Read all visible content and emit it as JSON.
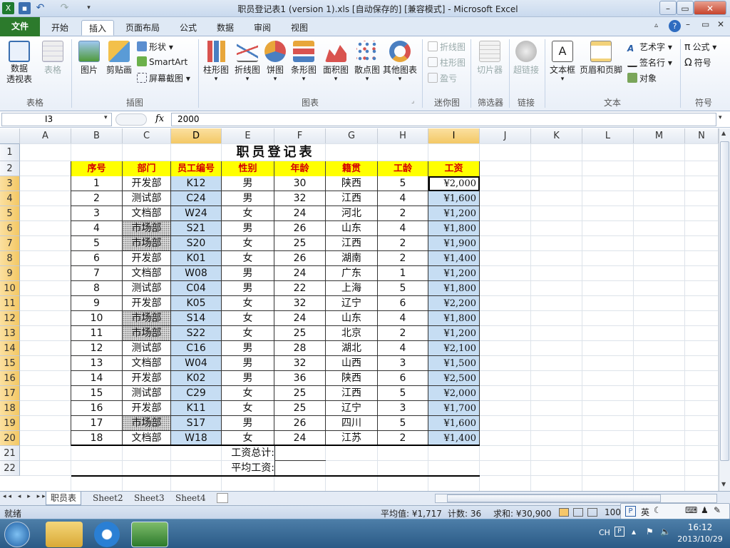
{
  "titlebar": {
    "title": "职员登记表1 (version 1).xls [自动保存的]  [兼容模式] - Microsoft Excel",
    "minimize": "–",
    "restore": "▭",
    "close": "✕"
  },
  "tabs": {
    "file": "文件",
    "home": "开始",
    "insert": "插入",
    "page_layout": "页面布局",
    "formulas": "公式",
    "data": "数据",
    "review": "审阅",
    "view": "视图"
  },
  "ribbon": {
    "pivot": "数据\n透视表",
    "table": "表格",
    "group_tables": "表格",
    "picture": "图片",
    "clipart": "剪贴画",
    "shapes": "形状",
    "smartart": "SmartArt",
    "screenshot": "屏幕截图",
    "group_illustrations": "插图",
    "column_chart": "柱形图",
    "line_chart": "折线图",
    "pie_chart": "饼图",
    "bar_chart": "条形图",
    "area_chart": "面积图",
    "scatter_chart": "散点图",
    "other_charts": "其他图表",
    "group_charts": "图表",
    "spark_line": "折线图",
    "spark_column": "柱形图",
    "spark_winloss": "盈亏",
    "group_sparklines": "迷你图",
    "slicer": "切片器",
    "group_filter": "筛选器",
    "hyperlink": "超链接",
    "group_links": "链接",
    "textbox": "文本框",
    "header_footer": "页眉和页脚",
    "wordart": "艺术字",
    "signature": "签名行",
    "object": "对象",
    "group_text": "文本",
    "equation": "公式",
    "symbol": "符号",
    "group_symbols": "符号"
  },
  "formula_bar": {
    "name_box": "I3",
    "fx": "fx",
    "value": "2000"
  },
  "columns": [
    "A",
    "B",
    "C",
    "D",
    "E",
    "F",
    "G",
    "H",
    "I",
    "J",
    "K",
    "L",
    "M",
    "N"
  ],
  "rows": [
    "1",
    "2",
    "3",
    "4",
    "5",
    "6",
    "7",
    "8",
    "9",
    "10",
    "11",
    "12",
    "13",
    "14",
    "15",
    "16",
    "17",
    "18",
    "19",
    "20",
    "21",
    "22"
  ],
  "sheet": {
    "title": "职员登记表",
    "headers": [
      "序号",
      "部门",
      "员工编号",
      "性别",
      "年龄",
      "籍贯",
      "工龄",
      "工资"
    ],
    "records": [
      [
        "1",
        "开发部",
        "K12",
        "男",
        "30",
        "陕西",
        "5",
        "¥2,000"
      ],
      [
        "2",
        "测试部",
        "C24",
        "男",
        "32",
        "江西",
        "4",
        "¥1,600"
      ],
      [
        "3",
        "文档部",
        "W24",
        "女",
        "24",
        "河北",
        "2",
        "¥1,200"
      ],
      [
        "4",
        "市场部",
        "S21",
        "男",
        "26",
        "山东",
        "4",
        "¥1,800"
      ],
      [
        "5",
        "市场部",
        "S20",
        "女",
        "25",
        "江西",
        "2",
        "¥1,900"
      ],
      [
        "6",
        "开发部",
        "K01",
        "女",
        "26",
        "湖南",
        "2",
        "¥1,400"
      ],
      [
        "7",
        "文档部",
        "W08",
        "男",
        "24",
        "广东",
        "1",
        "¥1,200"
      ],
      [
        "8",
        "测试部",
        "C04",
        "男",
        "22",
        "上海",
        "5",
        "¥1,800"
      ],
      [
        "9",
        "开发部",
        "K05",
        "女",
        "32",
        "辽宁",
        "6",
        "¥2,200"
      ],
      [
        "10",
        "市场部",
        "S14",
        "女",
        "24",
        "山东",
        "4",
        "¥1,800"
      ],
      [
        "11",
        "市场部",
        "S22",
        "女",
        "25",
        "北京",
        "2",
        "¥1,200"
      ],
      [
        "12",
        "测试部",
        "C16",
        "男",
        "28",
        "湖北",
        "4",
        "¥2,100"
      ],
      [
        "13",
        "文档部",
        "W04",
        "男",
        "32",
        "山西",
        "3",
        "¥1,500"
      ],
      [
        "14",
        "开发部",
        "K02",
        "男",
        "36",
        "陕西",
        "6",
        "¥2,500"
      ],
      [
        "15",
        "测试部",
        "C29",
        "女",
        "25",
        "江西",
        "5",
        "¥2,000"
      ],
      [
        "16",
        "开发部",
        "K11",
        "女",
        "25",
        "辽宁",
        "3",
        "¥1,700"
      ],
      [
        "17",
        "市场部",
        "S17",
        "男",
        "26",
        "四川",
        "5",
        "¥1,600"
      ],
      [
        "18",
        "文档部",
        "W18",
        "女",
        "24",
        "江苏",
        "2",
        "¥1,400"
      ]
    ],
    "total_label": "工资总计:",
    "avg_label": "平均工资:"
  },
  "sheet_tabs": [
    "职员表",
    "Sheet2",
    "Sheet3",
    "Sheet4"
  ],
  "status": {
    "ready": "就绪",
    "average": "平均值: ¥1,717",
    "count": "计数: 36",
    "sum": "求和: ¥30,900",
    "zoom": "100",
    "ime": "英"
  },
  "taskbar": {
    "lang": "CH",
    "time": "16:12",
    "date": "2013/10/29"
  }
}
